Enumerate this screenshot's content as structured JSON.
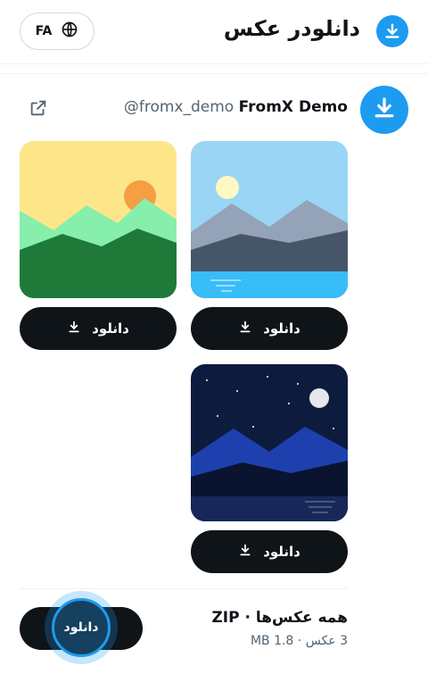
{
  "header": {
    "title": "دانلودر عکس",
    "lang_code": "FA",
    "logo_icon": "download-icon",
    "lang_icon": "globe-icon"
  },
  "profile": {
    "name": "FromX Demo",
    "handle": "@fromx_demo",
    "link_icon": "external-link-icon",
    "avatar_icon": "download-icon"
  },
  "images": [
    {
      "label": "دانلود",
      "scene": "desert-sunset"
    },
    {
      "label": "دانلود",
      "scene": "lake-mountains"
    },
    {
      "label": "دانلود",
      "scene": "night-mountains"
    }
  ],
  "zip": {
    "title": "همه عکس‌ها · ZIP",
    "meta": "3 عکس · 1.8 MB",
    "button_label": "دانلود"
  },
  "colors": {
    "accent": "#1d9bf0",
    "button_bg": "#0f1419",
    "text_secondary": "#536471"
  }
}
